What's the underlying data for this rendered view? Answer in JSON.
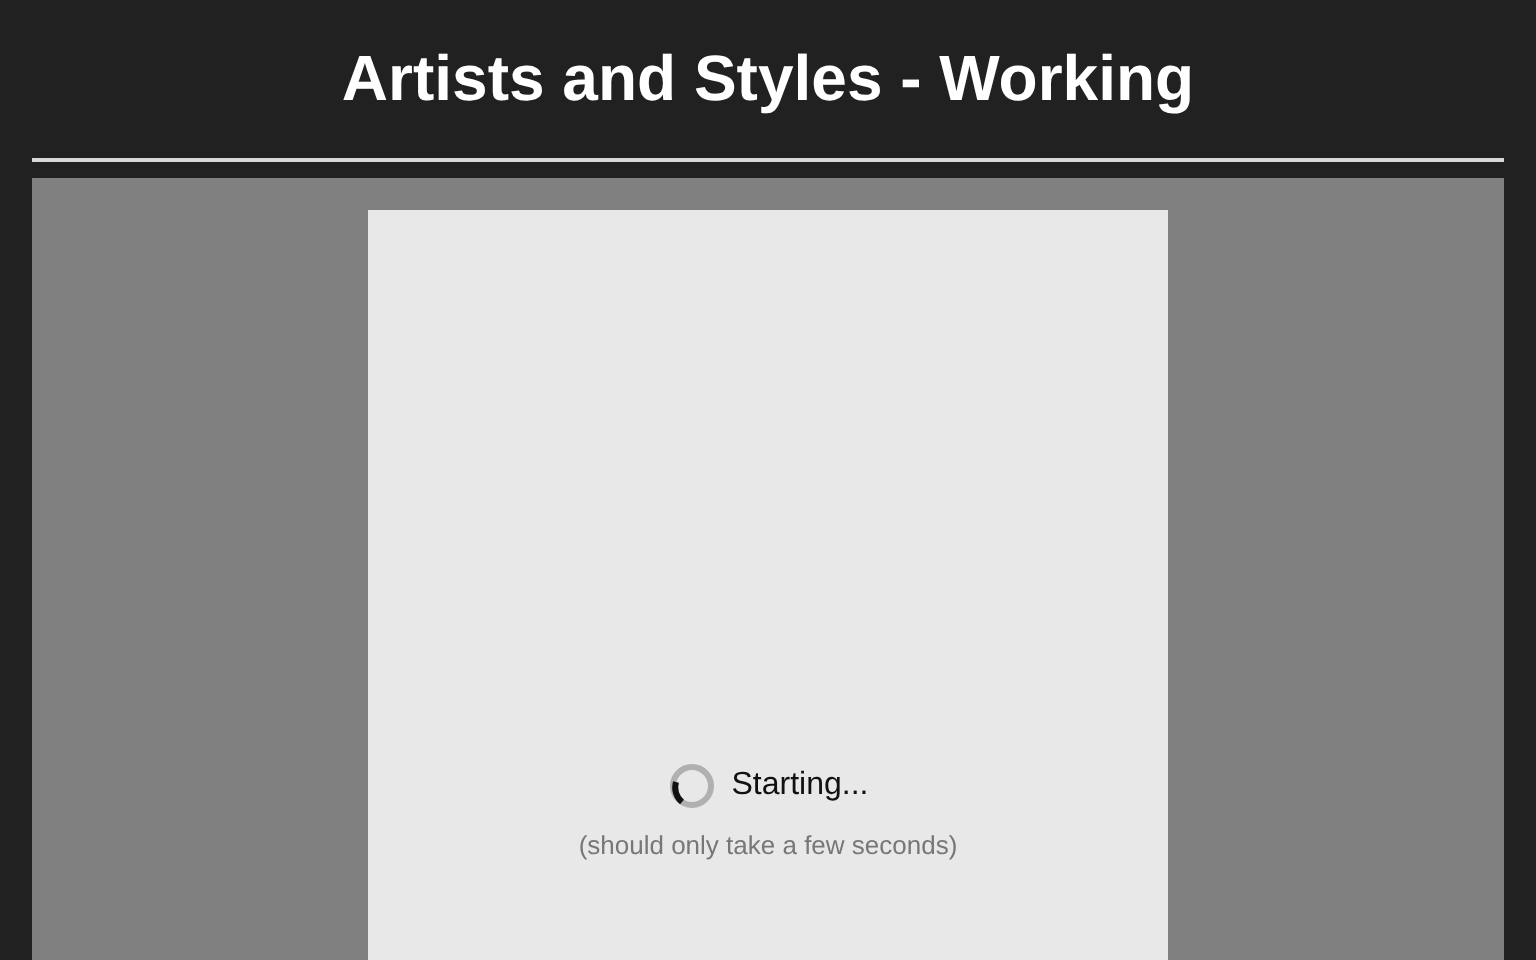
{
  "title": "Artists and Styles - Working",
  "loader": {
    "status": "Starting...",
    "hint": "(should only take a few seconds)"
  }
}
